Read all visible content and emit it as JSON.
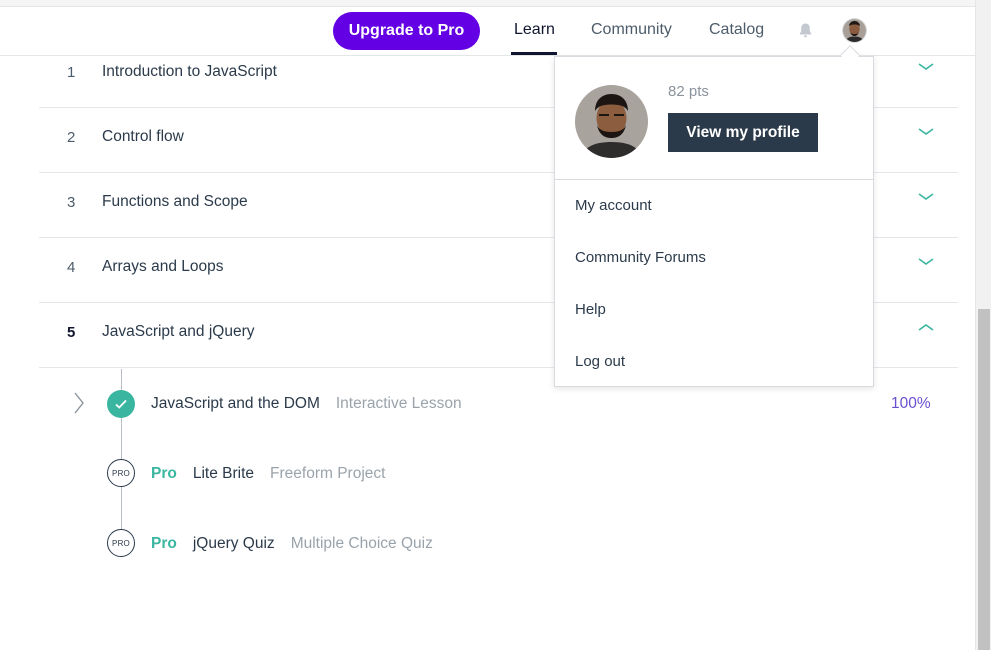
{
  "nav": {
    "upgrade_label": "Upgrade to Pro",
    "links": [
      "Learn",
      "Community",
      "Catalog"
    ],
    "active_link": "Learn",
    "bell_icon": "bell-icon",
    "avatar_icon": "user-avatar"
  },
  "modules": [
    {
      "num": "1",
      "title": "Introduction to JavaScript",
      "state": "collapsed"
    },
    {
      "num": "2",
      "title": "Control flow",
      "state": "collapsed"
    },
    {
      "num": "3",
      "title": "Functions and Scope",
      "state": "collapsed"
    },
    {
      "num": "4",
      "title": "Arrays and Loops",
      "state": "collapsed"
    },
    {
      "num": "5",
      "title": "JavaScript and jQuery",
      "state": "expanded"
    }
  ],
  "lessons": [
    {
      "pro": "",
      "title": "JavaScript and the DOM",
      "type": "Interactive Lesson",
      "progress": "100%",
      "status_icon": "check-icon"
    },
    {
      "pro": "Pro",
      "title": "Lite Brite",
      "type": "Freeform Project",
      "badge": "PRO"
    },
    {
      "pro": "Pro",
      "title": "jQuery Quiz",
      "type": "Multiple Choice Quiz",
      "badge": "PRO"
    }
  ],
  "dropdown": {
    "points": "82 pts",
    "profile_button": "View my profile",
    "items": [
      "My account",
      "Community Forums",
      "Help",
      "Log out"
    ]
  },
  "colors": {
    "brand_purple": "#6400e4",
    "teal": "#3ab6a0",
    "navy": "#2b3a4a",
    "progress_purple": "#6b4fd0"
  }
}
